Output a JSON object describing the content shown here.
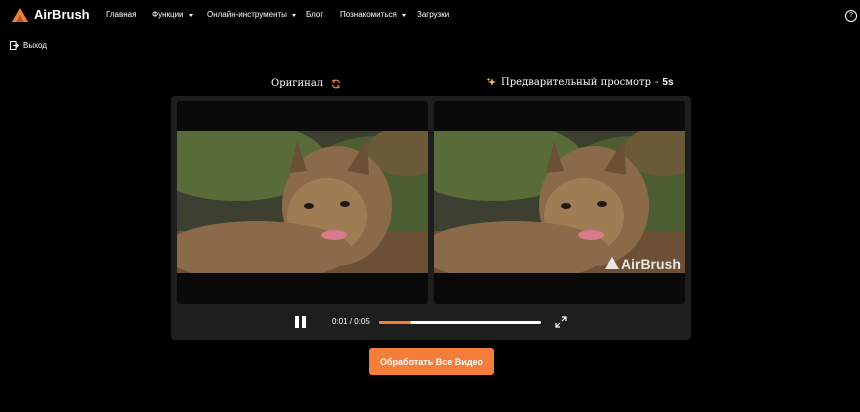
{
  "header": {
    "logo_text": "AirBrush",
    "menu": [
      {
        "label": "Главная",
        "dropdown": false
      },
      {
        "label": "Функции",
        "dropdown": true
      },
      {
        "label": "Онлайн-инструменты",
        "dropdown": true
      },
      {
        "label": "Блог",
        "dropdown": false
      },
      {
        "label": "Познакомиться",
        "dropdown": true
      },
      {
        "label": "Загрузки",
        "dropdown": false
      }
    ],
    "help_icon": "question-circle-icon",
    "help_symbol": "?"
  },
  "logout": {
    "label": "Выход",
    "icon": "logout-icon"
  },
  "compare": {
    "original_title": "Оригинал",
    "refresh_icon": "refresh-icon",
    "preview_icon": "sparkles-icon",
    "preview_title": "Предварительный просмотр",
    "preview_sep": "-",
    "preview_duration": "5s",
    "watermark": "AirBrush"
  },
  "player": {
    "time": "0:01 / 0:05",
    "progress": 0.2,
    "pause_icon": "pause-icon",
    "fullscreen_icon": "fullscreen-icon"
  },
  "cta": {
    "label": "Обработать Все Видео"
  },
  "colors": {
    "accent": "#f47d3a",
    "background": "#000000",
    "panel": "#1e1e1e"
  }
}
